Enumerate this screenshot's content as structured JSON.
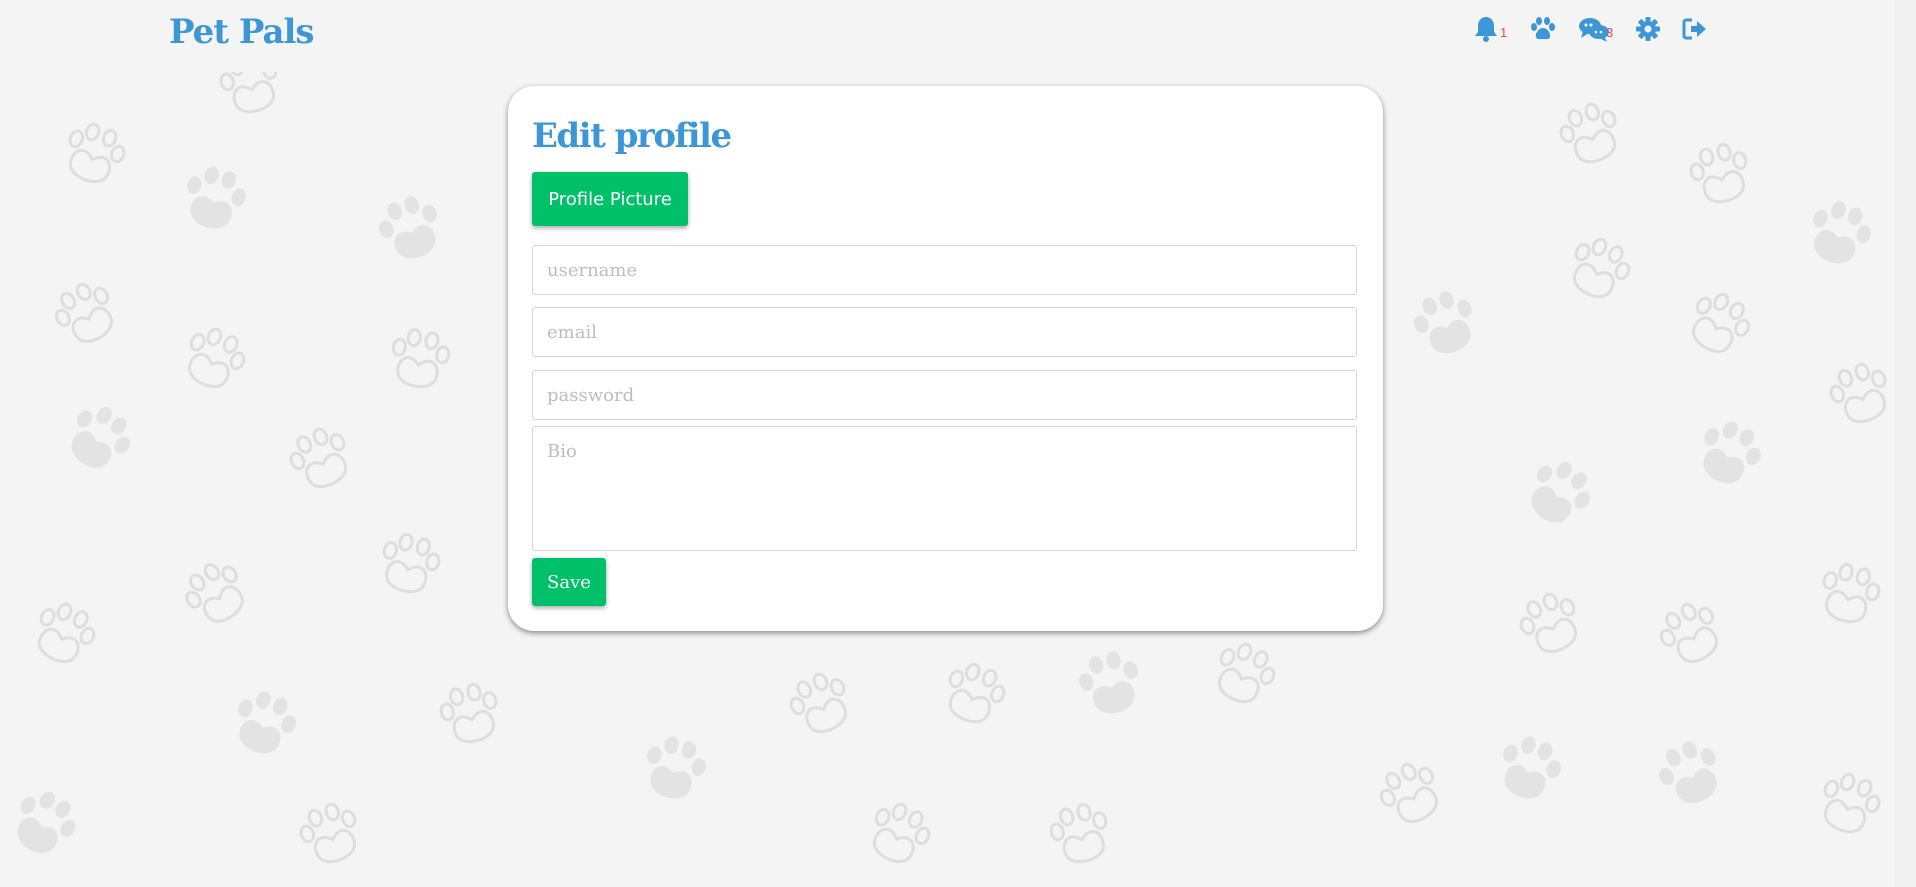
{
  "app": {
    "brand": "Pet Pals"
  },
  "nav": {
    "notifications": {
      "icon": "bell-icon",
      "count": "1"
    },
    "pets": {
      "icon": "paw-icon"
    },
    "messages": {
      "icon": "chat-bubbles-icon",
      "count": "3"
    },
    "settings": {
      "icon": "gear-icon"
    },
    "logout": {
      "icon": "sign-out-icon"
    }
  },
  "form": {
    "title": "Edit profile",
    "profile_picture_label": "Profile Picture",
    "username_placeholder": "username",
    "email_placeholder": "email",
    "password_placeholder": "password",
    "bio_placeholder": "Bio",
    "save_label": "Save"
  },
  "colors": {
    "accent_blue": "#3d97d6",
    "button_green": "#00c16a",
    "badge_red": "#e54b4b",
    "background": "#f4f4f4"
  }
}
